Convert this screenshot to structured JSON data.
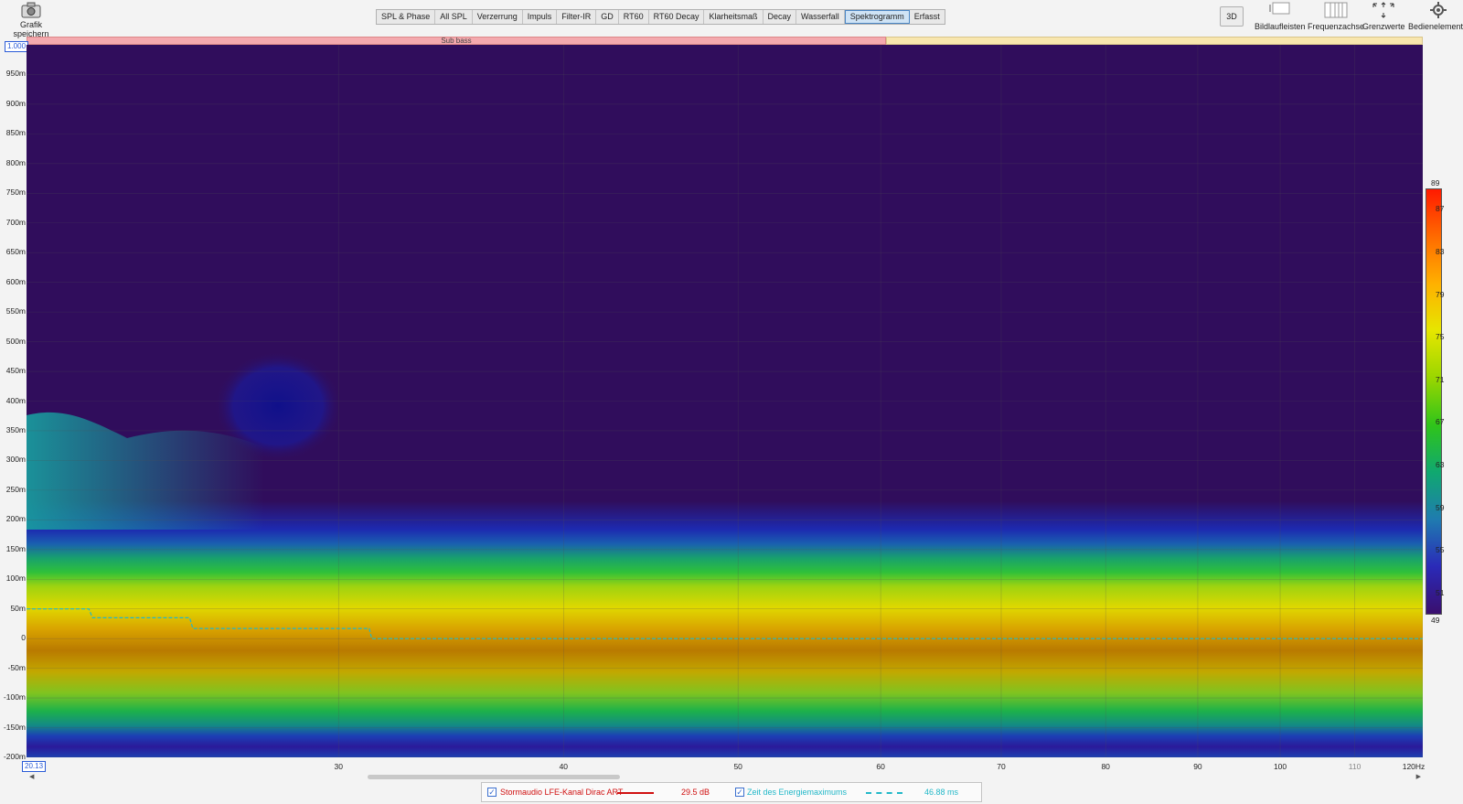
{
  "toolbar": {
    "save_label": "Grafik speichern",
    "tabs": [
      "SPL & Phase",
      "All SPL",
      "Verzerrung",
      "Impuls",
      "Filter-IR",
      "GD",
      "RT60",
      "RT60 Decay",
      "Klarheitsmaß",
      "Decay",
      "Wasserfall",
      "Spektrogramm",
      "Erfasst"
    ],
    "active_tab": "Spektrogramm",
    "btn_3d": "3D",
    "right_buttons": [
      "Bildlaufleisten",
      "Frequenzachse",
      "Grenzwerte",
      "Bedienelemente"
    ]
  },
  "band": {
    "sub_bass_label": "Sub bass",
    "sub_bass_color": "#f4a9ae",
    "rest_color": "#f8e6ae"
  },
  "axes": {
    "y_zoom_box": "1.000",
    "x_start_box": "20.13",
    "y_ticks": [
      "950m",
      "900m",
      "850m",
      "800m",
      "750m",
      "700m",
      "650m",
      "600m",
      "550m",
      "500m",
      "450m",
      "400m",
      "350m",
      "300m",
      "250m",
      "200m",
      "150m",
      "100m",
      "50m",
      "0",
      "-50m",
      "-100m",
      "-150m",
      "-200m"
    ],
    "x_ticks": [
      "30",
      "40",
      "50",
      "60",
      "70",
      "80",
      "90",
      "100",
      "110",
      "120Hz"
    ]
  },
  "color_scale": {
    "max": "89",
    "min": "49",
    "labels": [
      "87",
      "83",
      "79",
      "75",
      "71",
      "67",
      "63",
      "59",
      "55",
      "51"
    ],
    "stops": [
      "#ff1a00",
      "#ff6a00",
      "#ffb000",
      "#e6e600",
      "#9ad600",
      "#2fc41a",
      "#10a870",
      "#1f7bb0",
      "#2a2ab8",
      "#3a0f6e"
    ]
  },
  "chart_data": {
    "type": "heatmap",
    "x_unit": "Hz",
    "x_range": [
      20.13,
      120
    ],
    "x_scale": "log",
    "y_unit": "s",
    "y_range": [
      -0.2,
      1.0
    ],
    "colorbar_range_dB": [
      49,
      89
    ],
    "series": [
      {
        "name": "Zeit des Energiemaximums",
        "x": [
          20.13,
          21.8,
          21.9,
          24.8,
          24.9,
          31.2,
          31.3,
          120
        ],
        "y": [
          0.05,
          0.05,
          0.035,
          0.035,
          0.017,
          0.017,
          0.0,
          0.0
        ]
      }
    ]
  },
  "legend": {
    "item1_label": "Stormaudio LFE-Kanal Dirac ART",
    "item1_value": "29.5 dB",
    "item1_color": "#d01010",
    "item2_label": "Zeit des Energiemaximums",
    "item2_value": "46.88 ms",
    "item2_color": "#22b8c8"
  }
}
